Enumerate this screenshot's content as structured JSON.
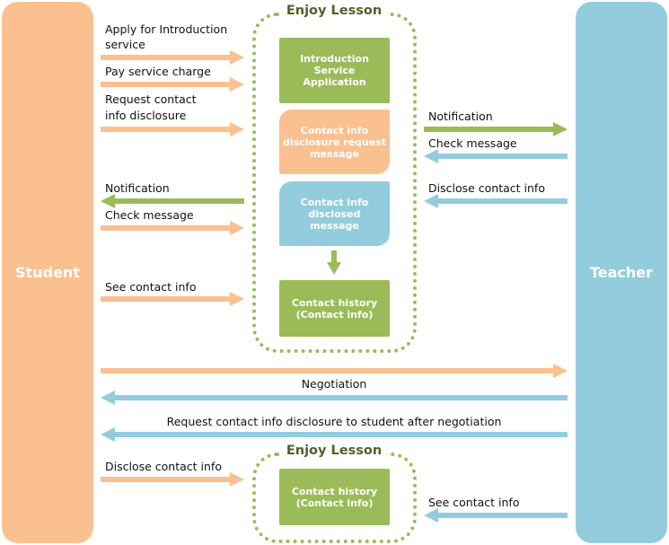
{
  "lanes": {
    "student": "Student",
    "teacher": "Teacher"
  },
  "groups": [
    {
      "title": "Enjoy Lesson",
      "boxes": [
        "Introduction Service Application",
        "Contact info disclosure request message",
        "Contact info disclosed message",
        "Contact history (Contact info)"
      ]
    },
    {
      "title": "Enjoy Lesson",
      "boxes": [
        "Contact history (Contact info)"
      ]
    }
  ],
  "student_side": {
    "apply_line1": "Apply  for Introduction",
    "apply_line2": "service",
    "pay": "Pay service charge",
    "request_line1": "Request contact",
    "request_line2": "info disclosure",
    "notification": "Notification",
    "check_message": "Check message",
    "see_contact": "See contact info",
    "disclose_contact": "Disclose contact info"
  },
  "teacher_side": {
    "notification": "Notification",
    "check_message": "Check message",
    "disclose_contact": "Disclose contact info",
    "see_contact": "See contact info"
  },
  "full_width": {
    "negotiation": "Negotiation",
    "request_after": "Request contact info disclosure to student  after negotiation"
  },
  "colors": {
    "student": "#FAC090",
    "teacher": "#93CDDD",
    "system": "#9BBB59",
    "group_title": "#4F6228"
  }
}
